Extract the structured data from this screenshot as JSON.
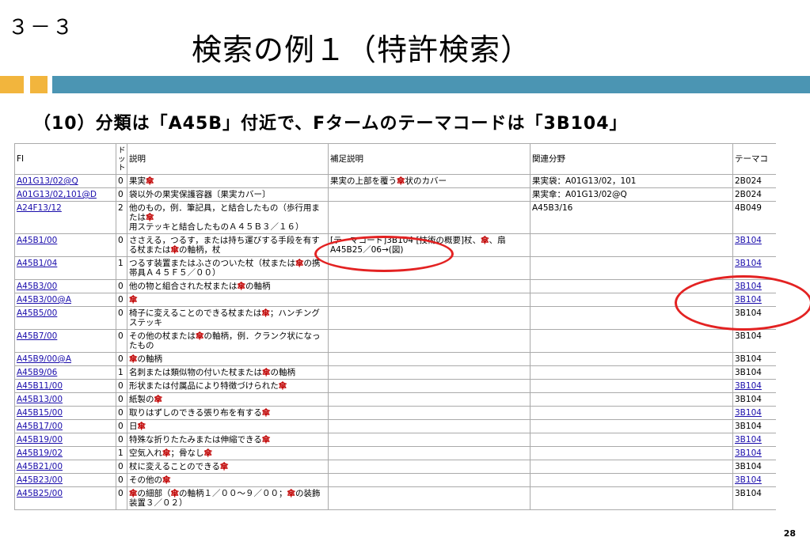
{
  "slide_number": "３－３",
  "title": "検索の例１（特許検索）",
  "subtitle": "（10）分類は「A45B」付近で、Fタームのテーマコードは「3B104」",
  "page_number": "28",
  "colors": {
    "accent_orange": "#f2b53d",
    "accent_blue": "#4b95b3",
    "highlight_red": "#c00000",
    "circle_red": "#e32222"
  },
  "table": {
    "headers": {
      "fi": "FI",
      "dot": "ドット",
      "desc": "説明",
      "supp": "補足説明",
      "related": "関連分野",
      "theme": "テーマコ"
    },
    "rows": [
      {
        "fi": "A01G13/02@Q",
        "dot": "0",
        "desc": "果実傘",
        "supp": "果実の上部を覆う傘状のカバー",
        "related": "果実袋：A01G13/02，101",
        "theme": "2B024"
      },
      {
        "fi": "A01G13/02,101@D",
        "dot": "0",
        "desc": "袋以外の果実保護容器〔果実カバー〕",
        "supp": "",
        "related": "果実傘：A01G13/02@Q",
        "theme": "2B024"
      },
      {
        "fi": "A24F13/12",
        "dot": "2",
        "desc": "他のもの，例．筆記具，と結合したもの（歩行用または傘用ステッキと結合したものＡ４５Ｂ３／１６）",
        "supp": "",
        "related": "A45B3/16",
        "theme": "4B049"
      },
      {
        "fi": "A45B1/00",
        "dot": "0",
        "desc": "ささえる，つるす，または持ち運びする手段を有する杖または傘の軸柄，杖",
        "supp": "[テーマコード]3B104 [技術の概要]杖、傘、扇 A45B25／06→(図)",
        "related": "",
        "theme": "3B104"
      },
      {
        "fi": "A45B1/04",
        "dot": "1",
        "desc": "つるす装置またはふさのついた杖（杖または傘の携帯具Ａ４５Ｆ５／００）",
        "supp": "",
        "related": "",
        "theme": "3B104"
      },
      {
        "fi": "A45B3/00",
        "dot": "0",
        "desc": "他の物と組合された杖または傘の軸柄",
        "supp": "",
        "related": "",
        "theme": "3B104"
      },
      {
        "fi": "A45B3/00@A",
        "dot": "0",
        "desc": "傘",
        "supp": "",
        "related": "",
        "theme": "3B104"
      },
      {
        "fi": "A45B5/00",
        "dot": "0",
        "desc": "椅子に変えることのできる杖または傘；ハンチングステッキ",
        "supp": "",
        "related": "",
        "theme": "3B104"
      },
      {
        "fi": "A45B7/00",
        "dot": "0",
        "desc": "その他の杖または傘の軸柄，例．クランク状になったもの",
        "supp": "",
        "related": "",
        "theme": "3B104"
      },
      {
        "fi": "A45B9/00@A",
        "dot": "0",
        "desc": "傘の軸柄",
        "supp": "",
        "related": "",
        "theme": "3B104"
      },
      {
        "fi": "A45B9/06",
        "dot": "1",
        "desc": "名刺または類似物の付いた杖または傘の軸柄",
        "supp": "",
        "related": "",
        "theme": "3B104"
      },
      {
        "fi": "A45B11/00",
        "dot": "0",
        "desc": "形状または付属品により特徴づけられた傘",
        "supp": "",
        "related": "",
        "theme": "3B104"
      },
      {
        "fi": "A45B13/00",
        "dot": "0",
        "desc": "紙製の傘",
        "supp": "",
        "related": "",
        "theme": "3B104"
      },
      {
        "fi": "A45B15/00",
        "dot": "0",
        "desc": "取りはずしのできる張り布を有する傘",
        "supp": "",
        "related": "",
        "theme": "3B104"
      },
      {
        "fi": "A45B17/00",
        "dot": "0",
        "desc": "日傘",
        "supp": "",
        "related": "",
        "theme": "3B104"
      },
      {
        "fi": "A45B19/00",
        "dot": "0",
        "desc": "特殊な折りたたみまたは伸縮できる傘",
        "supp": "",
        "related": "",
        "theme": "3B104"
      },
      {
        "fi": "A45B19/02",
        "dot": "1",
        "desc": "空気入れ傘；骨なし傘",
        "supp": "",
        "related": "",
        "theme": "3B104"
      },
      {
        "fi": "A45B21/00",
        "dot": "0",
        "desc": "杖に変えることのできる傘",
        "supp": "",
        "related": "",
        "theme": "3B104"
      },
      {
        "fi": "A45B23/00",
        "dot": "0",
        "desc": "その他の傘",
        "supp": "",
        "related": "",
        "theme": "3B104"
      },
      {
        "fi": "A45B25/00",
        "dot": "0",
        "desc": "傘の細部（傘の軸柄１／００～９／００；傘の装飾装置３／０２）",
        "supp": "",
        "related": "",
        "theme": "3B104"
      }
    ]
  }
}
